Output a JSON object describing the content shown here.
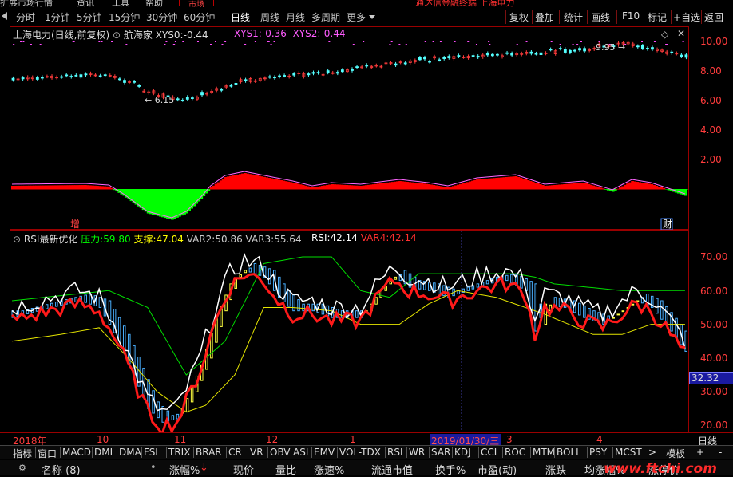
{
  "menubar": {
    "items": [
      "扩展市场行情",
      "资讯",
      "工具",
      "帮助"
    ],
    "market_tab": "市场",
    "banner": "通达信金融终端 上海电力"
  },
  "toolbar": {
    "periods": [
      "分时",
      "1分钟",
      "5分钟",
      "15分钟",
      "30分钟",
      "60分钟",
      "日线",
      "周线",
      "月线",
      "多周期",
      "更多"
    ],
    "active_period": "日线",
    "right_buttons": [
      "复权",
      "叠加",
      "统计",
      "画线",
      "F10",
      "标记",
      "+自选",
      "返回"
    ]
  },
  "price_panel": {
    "title": "上海电力(日线,前复权)",
    "indicator": "航海家",
    "xys0_label": "XYS0:",
    "xys0": "-0.44",
    "xys1_label": "XYS1:",
    "xys1": "-0.36",
    "xys2_label": "XYS2:",
    "xys2": "-0.44",
    "low_mark": "6.15",
    "high_mark": "9.95",
    "y_ticks": [
      "10.00",
      "8.00",
      "6.00",
      "4.00",
      "2.00"
    ],
    "marker_left": "增",
    "marker_right": "财",
    "colors": {
      "up": "#ff3c3c",
      "down": "#54ffff",
      "macd_up": "#ff0000",
      "macd_down": "#00ff00"
    }
  },
  "rsi_panel": {
    "title": "RSI最新优化",
    "pressure_label": "压力:",
    "pressure": "59.80",
    "support_label": "支撑:",
    "support": "47.04",
    "var2_label": "VAR2:",
    "var2": "50.86",
    "var3_label": "VAR3:",
    "var3": "55.64",
    "rsi_label": "RSI:",
    "rsi": "42.14",
    "var4_label": "VAR4:",
    "var4": "42.14",
    "y_ticks": [
      "70.00",
      "60.00",
      "50.00",
      "40.00",
      "30.00",
      "20.00"
    ],
    "cursor_value": "32.32"
  },
  "date_axis": {
    "labels": [
      "2018年",
      "10",
      "11",
      "12",
      "1",
      "2019/01/30/三",
      "3",
      "4"
    ],
    "right_label": "日线"
  },
  "indicator_tabs": [
    "指标",
    "窗口",
    "MACD",
    "DMI",
    "DMA",
    "FSL",
    "TRIX",
    "BRAR",
    "CR",
    "VR",
    "OBV",
    "ASI",
    "EMV",
    "VOL-TDX",
    "RSI",
    "WR",
    "SAR",
    "KDJ",
    "CCI",
    "ROC",
    "MTM",
    "BOLL",
    "PSY",
    "MCST",
    "模板"
  ],
  "column_headers": [
    "名称 (8)",
    "涨幅%",
    "现价",
    "量比",
    "涨速%",
    "流通市值",
    "换手%",
    "市盈(动)",
    "涨跌",
    "均涨幅%",
    "涨停价"
  ],
  "watermark": "www.ftchi.com"
}
